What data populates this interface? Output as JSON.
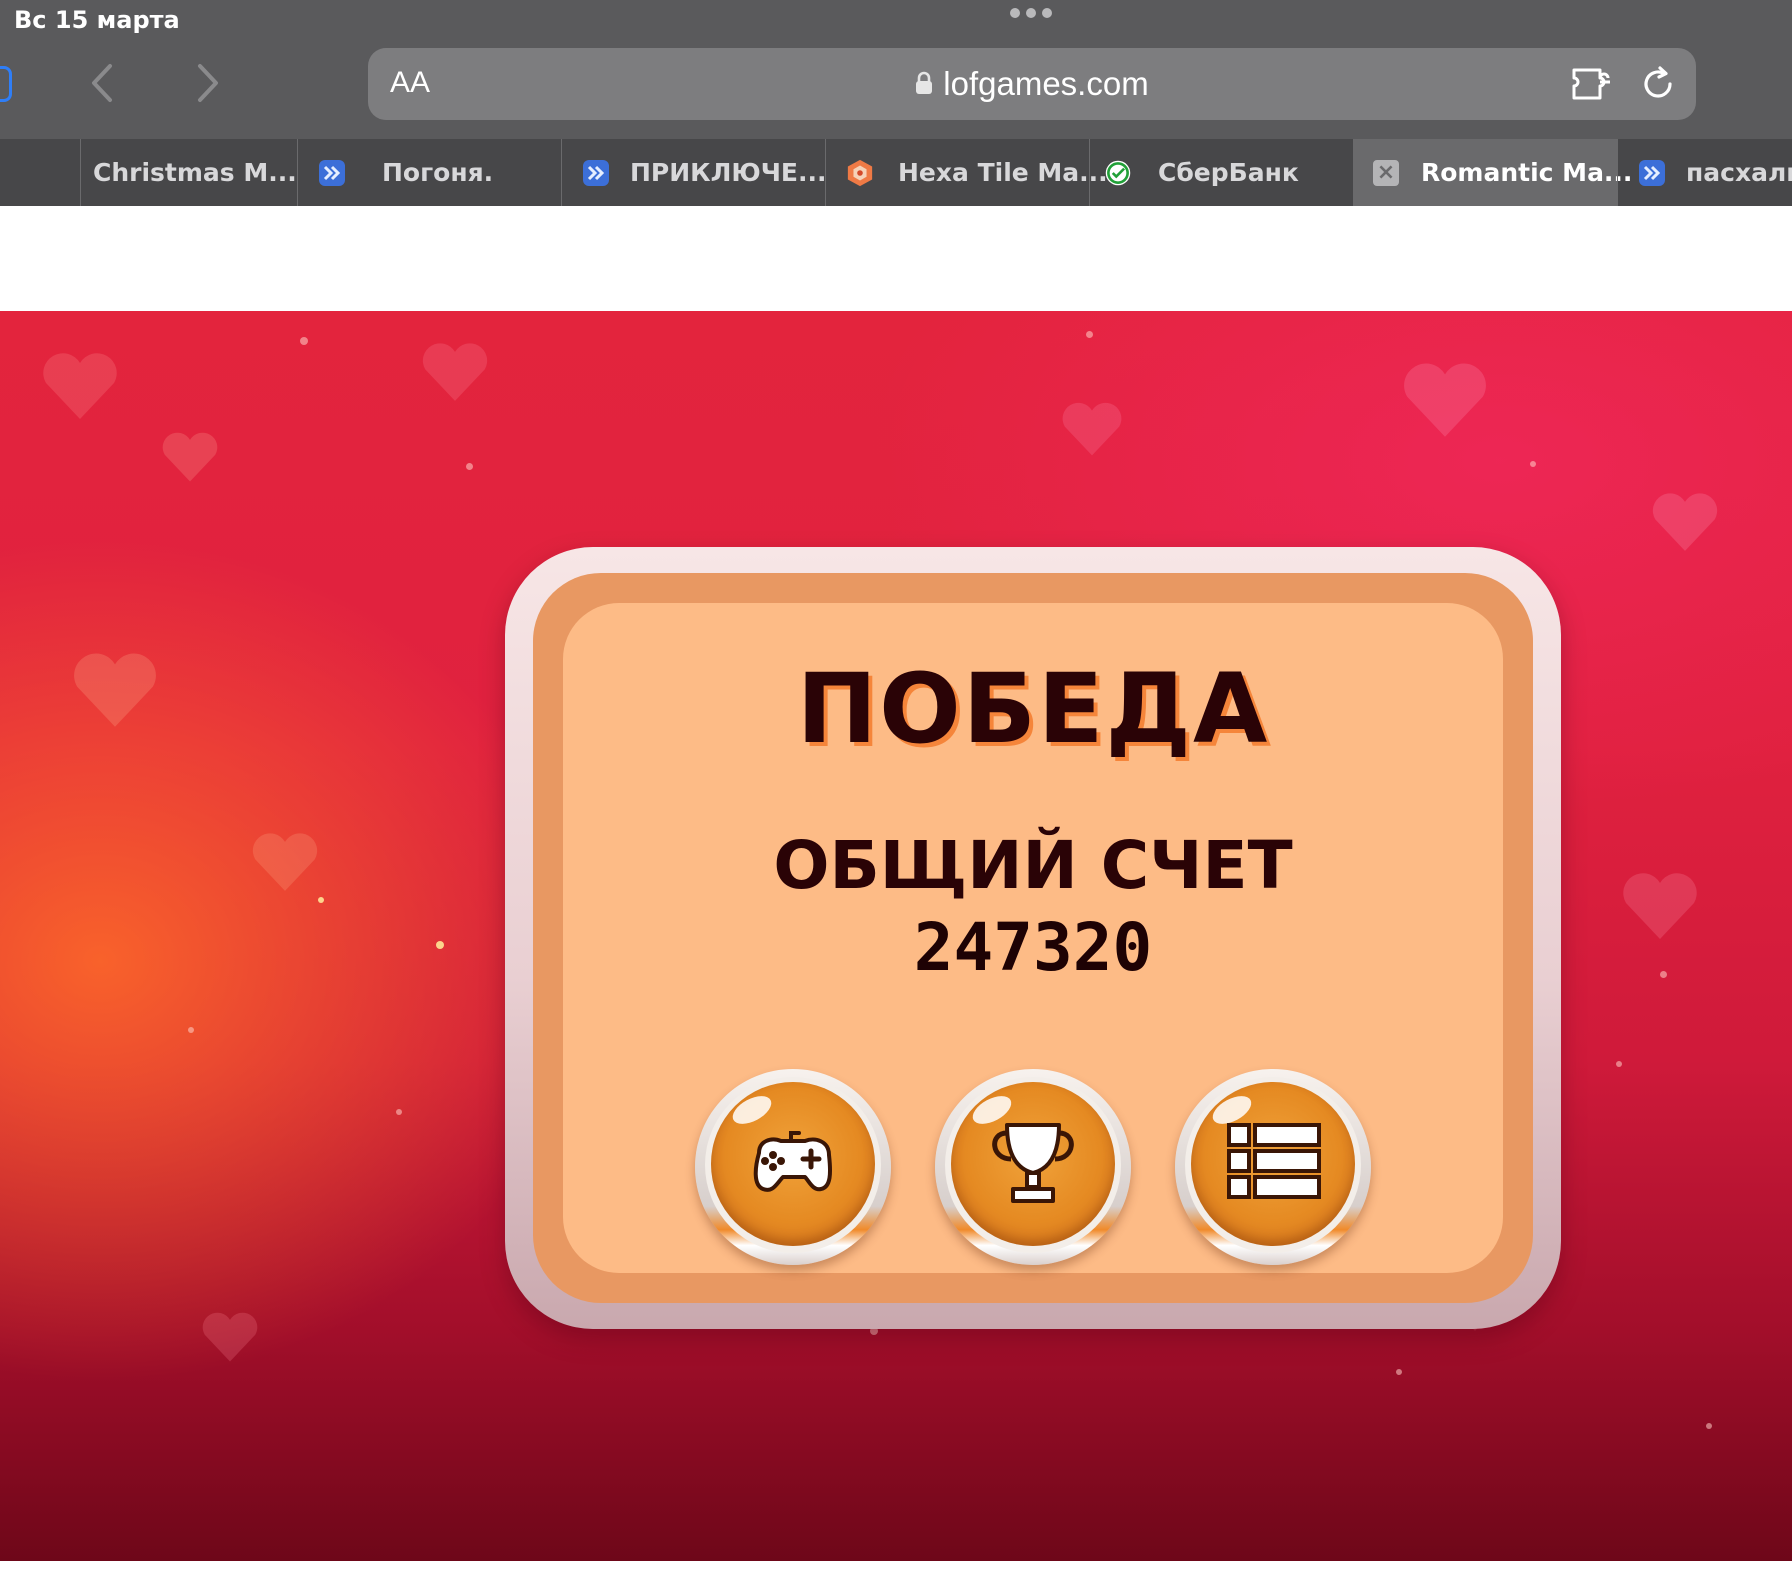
{
  "status_bar": {
    "date": "Вс 15 марта"
  },
  "browser": {
    "text_size_label": "AA",
    "url": "lofgames.com",
    "icons": {
      "back": "chevron-left-icon",
      "forward": "chevron-right-icon",
      "lock": "lock-icon",
      "extension": "extension-icon",
      "reload": "reload-icon"
    }
  },
  "tabs": [
    {
      "label": "Christmas M...",
      "icon": "none",
      "active": false
    },
    {
      "label": "Погоня.",
      "icon": "lofgames-favicon",
      "active": false
    },
    {
      "label": "ПРИКЛЮЧЕ...",
      "icon": "lofgames-favicon",
      "active": false
    },
    {
      "label": "Hexa Tile Ma...",
      "icon": "hexa-favicon",
      "active": false
    },
    {
      "label": "СберБанк",
      "icon": "sberbank-favicon",
      "active": false
    },
    {
      "label": "Romantic Ma...",
      "icon": "close-icon",
      "active": true
    },
    {
      "label": "пасхальн",
      "icon": "lofgames-favicon",
      "active": false
    }
  ],
  "game": {
    "title": "ПОБЕДА",
    "score_label": "ОБЩИЙ СЧЕТ",
    "score_value": "247320",
    "buttons": [
      {
        "name": "play-again",
        "icon": "gamepad-icon"
      },
      {
        "name": "leaderboard",
        "icon": "trophy-icon"
      },
      {
        "name": "level-list",
        "icon": "list-icon"
      }
    ]
  },
  "colors": {
    "chrome": "#5a5a5c",
    "tabbar": "#474749",
    "active_tab": "#6a6a6c",
    "panel_face": "#fdbb86",
    "panel_border": "#e89862",
    "title_text": "#2a0306",
    "button_orange": "#e58a22"
  }
}
